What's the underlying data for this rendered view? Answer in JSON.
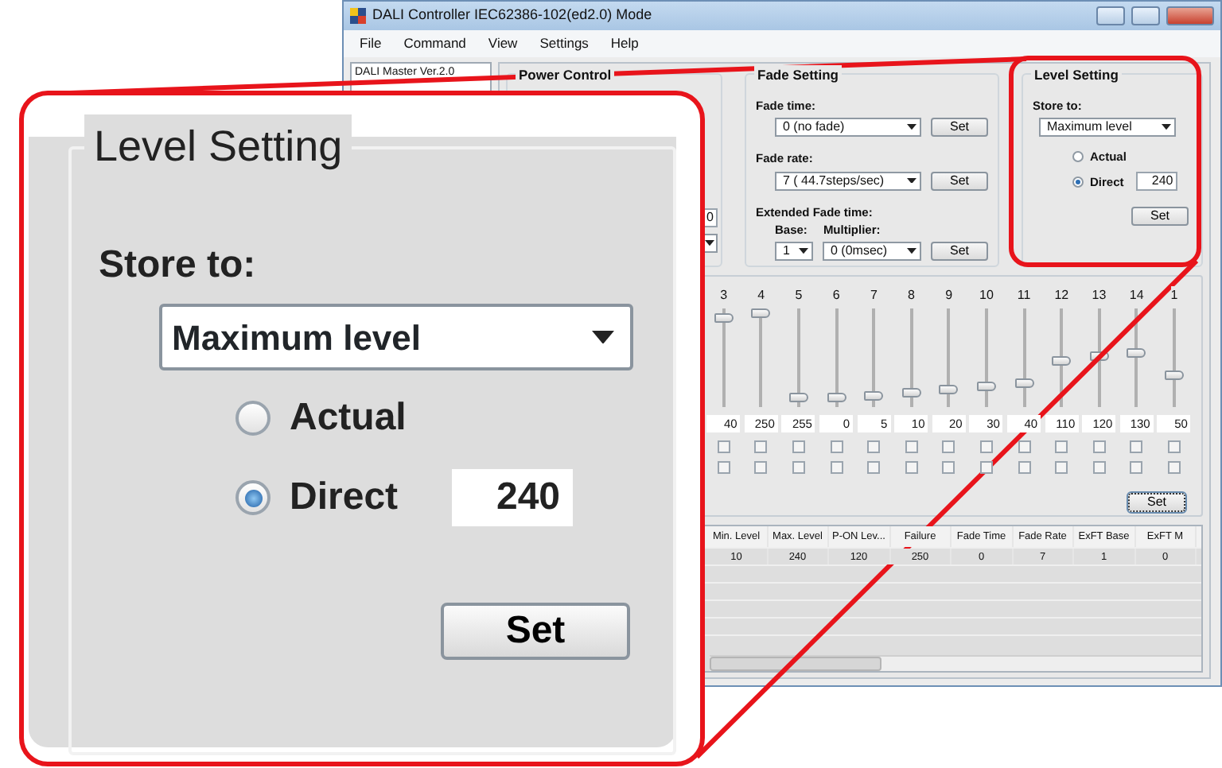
{
  "window": {
    "title": "DALI Controller IEC62386-102(ed2.0) Mode",
    "menu": [
      "File",
      "Command",
      "View",
      "Settings",
      "Help"
    ]
  },
  "tree": {
    "root": "DALI Master Ver.2.0"
  },
  "power_control": {
    "title": "Power Control",
    "value": "0"
  },
  "fade_setting": {
    "title": "Fade Setting",
    "rows": [
      {
        "kind": "single",
        "label": "Fade time:",
        "select": "0 (no fade)",
        "button": "Set"
      },
      {
        "kind": "single",
        "label": "Fade rate:",
        "select": "7 ( 44.7steps/sec)",
        "button": "Set"
      },
      {
        "kind": "pair",
        "label": "Extended Fade time:",
        "sublabels": [
          "Base:",
          "Multiplier:"
        ],
        "selects": [
          "1",
          "0 (0msec)"
        ],
        "button": "Set"
      }
    ]
  },
  "level_setting": {
    "title": "Level Setting",
    "store_label": "Store to:",
    "select": "Maximum level",
    "options": [
      {
        "label": "Actual",
        "selected": false
      },
      {
        "label": "Direct",
        "selected": true
      }
    ],
    "direct_value": "240",
    "button": "Set"
  },
  "channels": [
    {
      "label": "3",
      "level": 0.95,
      "value": "40",
      "checks": [
        {
          "checked": false
        },
        {
          "checked": false
        }
      ]
    },
    {
      "label": "4",
      "level": 1,
      "value": "250",
      "checks": [
        {
          "checked": false
        },
        {
          "checked": false
        }
      ]
    },
    {
      "label": "5",
      "level": 0.05,
      "value": "255",
      "checks": [
        {
          "checked": false
        },
        {
          "checked": false
        }
      ]
    },
    {
      "label": "6",
      "level": 0.05,
      "value": "0",
      "checks": [
        {
          "checked": false
        },
        {
          "checked": false
        }
      ]
    },
    {
      "label": "7",
      "level": 0.08,
      "value": "5",
      "checks": [
        {
          "checked": false
        },
        {
          "checked": false
        }
      ]
    },
    {
      "label": "8",
      "level": 0.1,
      "value": "10",
      "checks": [
        {
          "checked": false
        },
        {
          "checked": false
        }
      ]
    },
    {
      "label": "9",
      "level": 0.14,
      "value": "20",
      "checks": [
        {
          "checked": false
        },
        {
          "checked": false
        }
      ]
    },
    {
      "label": "10",
      "level": 0.18,
      "value": "30",
      "checks": [
        {
          "checked": false
        },
        {
          "checked": false
        }
      ]
    },
    {
      "label": "11",
      "level": 0.21,
      "value": "40",
      "checks": [
        {
          "checked": false
        },
        {
          "checked": false
        }
      ]
    },
    {
      "label": "12",
      "level": 0.47,
      "value": "110",
      "checks": [
        {
          "checked": false
        },
        {
          "checked": false
        }
      ]
    },
    {
      "label": "13",
      "level": 0.52,
      "value": "120",
      "checks": [
        {
          "checked": false
        },
        {
          "checked": false
        }
      ]
    },
    {
      "label": "14",
      "level": 0.56,
      "value": "130",
      "checks": [
        {
          "checked": false
        },
        {
          "checked": false
        }
      ]
    },
    {
      "label": "1",
      "level": 0.3,
      "value": "50",
      "checks": [
        {
          "checked": false
        },
        {
          "checked": false
        }
      ]
    }
  ],
  "channels_button": "Set",
  "table": {
    "columns": [
      "Min. Level",
      "Max. Level",
      "P-ON Lev...",
      "Failure",
      "Fade Time",
      "Fade Rate",
      "ExFT Base",
      "ExFT M"
    ],
    "rows": [
      [
        "10",
        "240",
        "120",
        "250",
        "0",
        "7",
        "1",
        "0"
      ]
    ]
  },
  "callout": {
    "title": "Level Setting",
    "store_label": "Store to:",
    "select": "Maximum level",
    "options": [
      {
        "label": "Actual",
        "selected": false
      },
      {
        "label": "Direct",
        "selected": true
      }
    ],
    "direct_value": "240",
    "button": "Set"
  }
}
